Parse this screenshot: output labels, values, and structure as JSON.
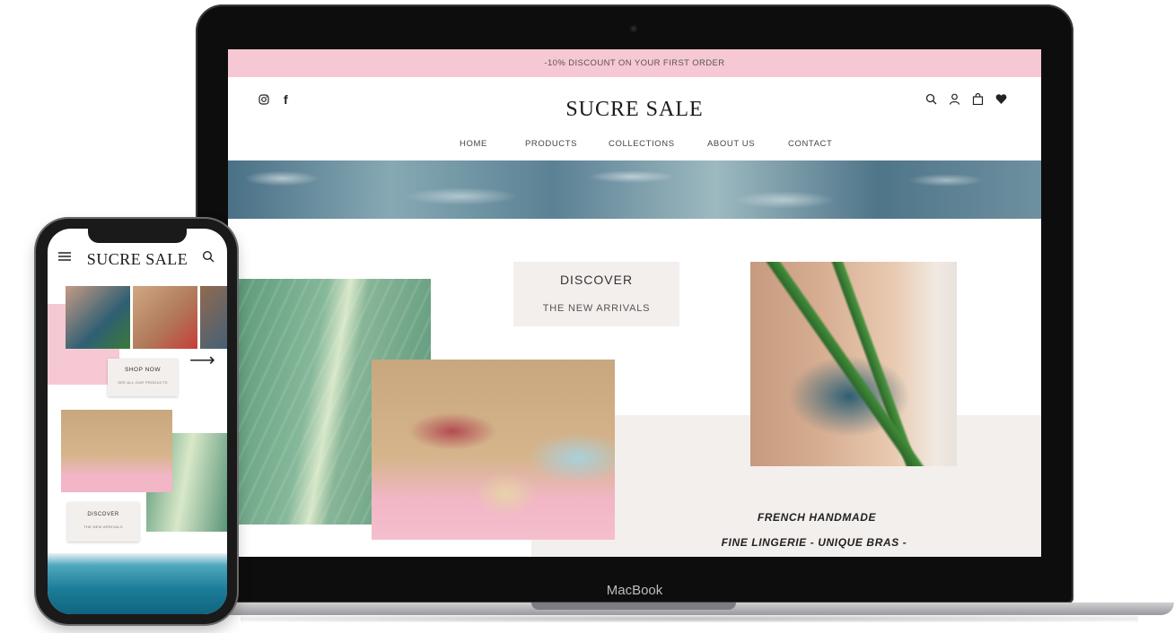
{
  "laptop": {
    "brand_label": "MacBook",
    "site": {
      "promo_bar": "-10% DISCOUNT ON YOUR FIRST ORDER",
      "logo": "SUCRE SALE",
      "social_icons": [
        "instagram-icon",
        "facebook-icon"
      ],
      "header_icons": [
        "search-icon",
        "account-icon",
        "bag-icon",
        "heart-icon"
      ],
      "nav": [
        "HOME",
        "PRODUCTS",
        "COLLECTIONS",
        "ABOUT US",
        "CONTACT"
      ],
      "discover": {
        "title": "DISCOVER",
        "subtitle": "THE NEW ARRIVALS"
      },
      "tagline_line1": "FRENCH HANDMADE",
      "tagline_line2": "FINE LINGERIE - UNIQUE BRAS -"
    },
    "colors": {
      "promo_pink": "#f6c8d3",
      "beige": "#f3efed"
    }
  },
  "phone": {
    "logo": "SUCRE SALE",
    "shop_now": {
      "title": "SHOP NOW",
      "subtitle": "SEE ALL OUR PRODUCTS"
    },
    "discover": {
      "title": "DISCOVER",
      "subtitle": "THE NEW ARRIVALS"
    },
    "icons": [
      "menu-icon",
      "search-icon",
      "arrow-right-icon"
    ]
  }
}
